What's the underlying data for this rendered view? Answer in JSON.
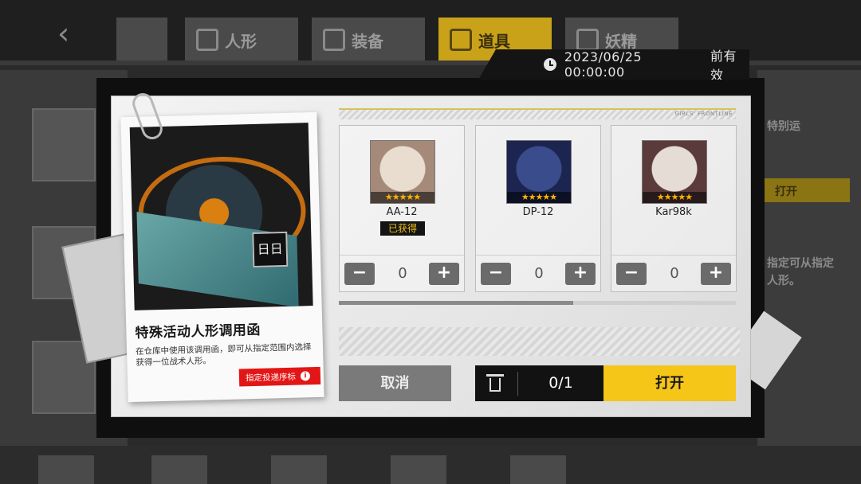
{
  "background": {
    "tabs": [
      {
        "label": "人形"
      },
      {
        "label": "装备"
      },
      {
        "label": "道具"
      },
      {
        "label": "妖精"
      }
    ],
    "right_panel": {
      "text1": "特别运",
      "text2": "指定可从指定",
      "text3": "人形。",
      "button": "打开"
    }
  },
  "date_banner": {
    "icon": "clock-icon",
    "date": "2023/06/25 00:00:00",
    "suffix": "前有效"
  },
  "item": {
    "name": "特殊活动人形调用函",
    "description": "在仓库中使用该调用函，即可从指定范围内选择获得一位战术人形。",
    "link_label": "指定投递序标",
    "chip_label": "日日"
  },
  "header_stripe_text": "GIRLS' FRONTLINE",
  "characters": [
    {
      "name": "AA-12",
      "stars": "★★★★★",
      "owned_label": "已获得",
      "owned": true,
      "count": "0",
      "colors": [
        "#e9ddd0",
        "#a58a7a"
      ]
    },
    {
      "name": "DP-12",
      "stars": "★★★★★",
      "owned_label": "",
      "owned": false,
      "count": "0",
      "colors": [
        "#3a4c8c",
        "#1c2550"
      ]
    },
    {
      "name": "Kar98k",
      "stars": "★★★★★",
      "owned_label": "",
      "owned": false,
      "count": "0",
      "colors": [
        "#e6dcd6",
        "#5a3a3a"
      ]
    }
  ],
  "scroll_progress": 0.59,
  "buttons": {
    "cancel": "取消",
    "counter": "0/1",
    "open": "打开"
  },
  "colors": {
    "accent_yellow": "#f5c518",
    "danger_red": "#e31616"
  }
}
